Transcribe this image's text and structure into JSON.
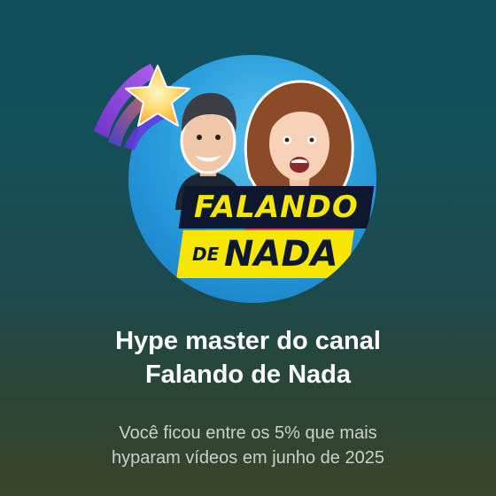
{
  "badge": {
    "channel_logo": {
      "line1": "FALANDO",
      "line2_prefix": "DE",
      "line2_main": "NADA"
    },
    "icon": "hype-star-icon"
  },
  "title": {
    "line1": "Hype master do canal",
    "line2": "Falando de Nada"
  },
  "subtitle": {
    "line1": "Você ficou entre os 5% que mais",
    "line2": "hyparam vídeos em junho de 2025"
  },
  "colors": {
    "logo_yellow": "#f6e600",
    "logo_navy": "#0d1730",
    "circle_blue": "#2b9fdd"
  }
}
